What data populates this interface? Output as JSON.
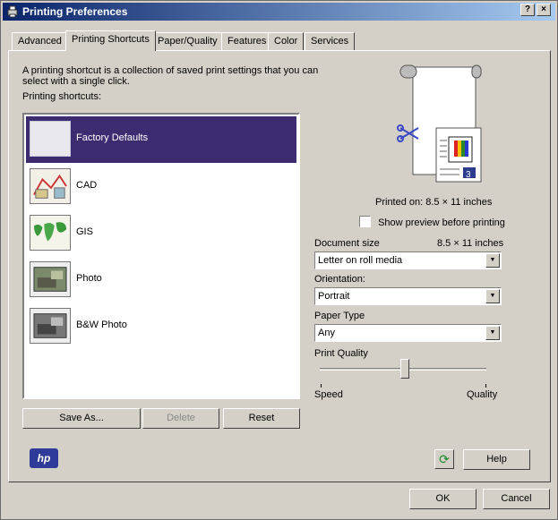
{
  "window": {
    "title": "Printing Preferences",
    "help_btn": "?",
    "close_btn": "×"
  },
  "tabs": [
    "Advanced",
    "Printing Shortcuts",
    "Paper/Quality",
    "Features",
    "Color",
    "Services"
  ],
  "shortcuts": {
    "description": "A printing shortcut is a collection of saved print settings that you can select with a single click.",
    "list_label": "Printing shortcuts:",
    "items": [
      {
        "label": "Factory Defaults",
        "selected": true
      },
      {
        "label": "CAD"
      },
      {
        "label": "GIS"
      },
      {
        "label": "Photo"
      },
      {
        "label": "B&W Photo"
      }
    ],
    "save_as": "Save As...",
    "delete": "Delete",
    "reset": "Reset"
  },
  "preview": {
    "printed_on": "Printed on: 8.5 × 11 inches",
    "show_preview": "Show preview before printing"
  },
  "document_size": {
    "label": "Document size",
    "value": "8.5 × 11 inches",
    "selected": "Letter on roll media"
  },
  "orientation": {
    "label": "Orientation:",
    "selected": "Portrait"
  },
  "paper_type": {
    "label": "Paper Type",
    "selected": "Any"
  },
  "print_quality": {
    "label": "Print Quality",
    "min_label": "Speed",
    "max_label": "Quality",
    "level": 0.5
  },
  "footer": {
    "help": "Help",
    "ok": "OK",
    "cancel": "Cancel",
    "logo": "hp"
  },
  "colors": {
    "titlebar": "#0a246a",
    "selection": "#3d2c70",
    "hp_blue": "#2f3b98"
  }
}
